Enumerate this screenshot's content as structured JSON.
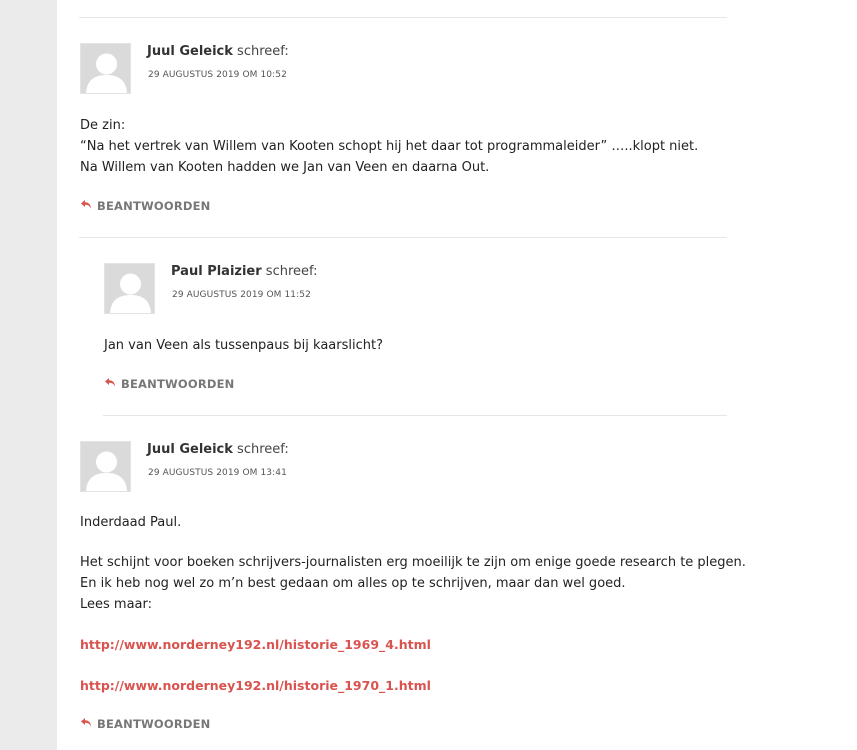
{
  "comments": [
    {
      "author": "Juul Geleick",
      "said": "schreef:",
      "date": "29 AUGUSTUS 2019 OM 10:52",
      "lines": [
        "De zin:",
        "“Na het vertrek van Willem van Kooten schopt hij het daar tot programmaleider” …..klopt niet.",
        "Na Willem van Kooten hadden we Jan van Veen en daarna Out."
      ],
      "reply_label": "BEANTWOORDEN"
    },
    {
      "author": "Paul Plaizier",
      "said": "schreef:",
      "date": "29 AUGUSTUS 2019 OM 11:52",
      "lines": [
        "Jan van Veen als tussenpaus bij kaarslicht?"
      ],
      "reply_label": "BEANTWOORDEN"
    },
    {
      "author": "Juul Geleick",
      "said": "schreef:",
      "date": "29 AUGUSTUS 2019 OM 13:41",
      "intro": "Inderdaad Paul.",
      "lines": [
        "Het schijnt voor boeken schrijvers-journalisten erg moeilijk te zijn om enige goede research te plegen.",
        "En ik heb nog wel zo m’n best gedaan om alles op te schrijven, maar dan wel goed.",
        "Lees maar:"
      ],
      "links": [
        "http://www.norderney192.nl/historie_1969_4.html",
        "http://www.norderney192.nl/historie_1970_1.html"
      ],
      "reply_label": "BEANTWOORDEN"
    }
  ],
  "colors": {
    "link": "#d9534f",
    "reply_icon": "#d9534f",
    "page_bg": "#ebebeb",
    "content_bg": "#ffffff"
  },
  "icons": {
    "avatar": "default-user-avatar",
    "reply": "reply-arrow-icon"
  }
}
